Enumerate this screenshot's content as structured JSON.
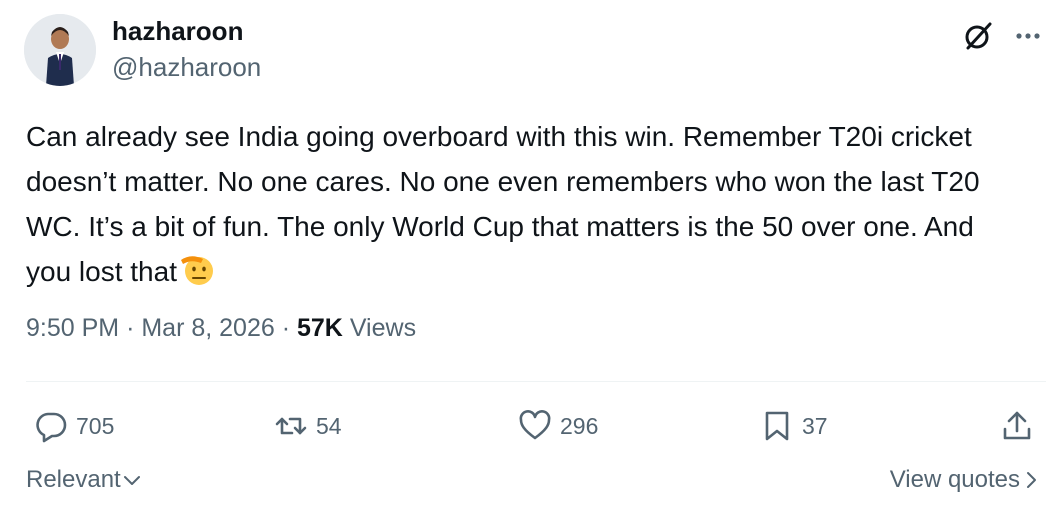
{
  "author": {
    "name": "hazharoon",
    "handle": "@hazharoon"
  },
  "tweet": {
    "text": "Can already see India going overboard with this win. Remember T20i cricket doesn’t matter. No one cares. No one even remembers who won the last T20 WC. It’s a bit of fun. The only World Cup that matters is the 50 over one. And you lost that",
    "emoji": "saluting-face-emoji"
  },
  "meta": {
    "time": "9:50 PM",
    "separator": "·",
    "date": "Mar 8, 2026",
    "views_count": "57K",
    "views_label": "Views"
  },
  "actions": {
    "replies": "705",
    "reposts": "54",
    "likes": "296",
    "bookmarks": "37"
  },
  "footer": {
    "sort_label": "Relevant",
    "view_quotes_label": "View quotes"
  },
  "icons": {
    "grok": "grok-icon",
    "more": "more-icon",
    "reply": "reply-icon",
    "repost": "repost-icon",
    "like": "heart-icon",
    "bookmark": "bookmark-icon",
    "share": "share-icon"
  },
  "colors": {
    "text": "#0f1419",
    "secondary": "#536471",
    "divider": "#eff3f4"
  }
}
